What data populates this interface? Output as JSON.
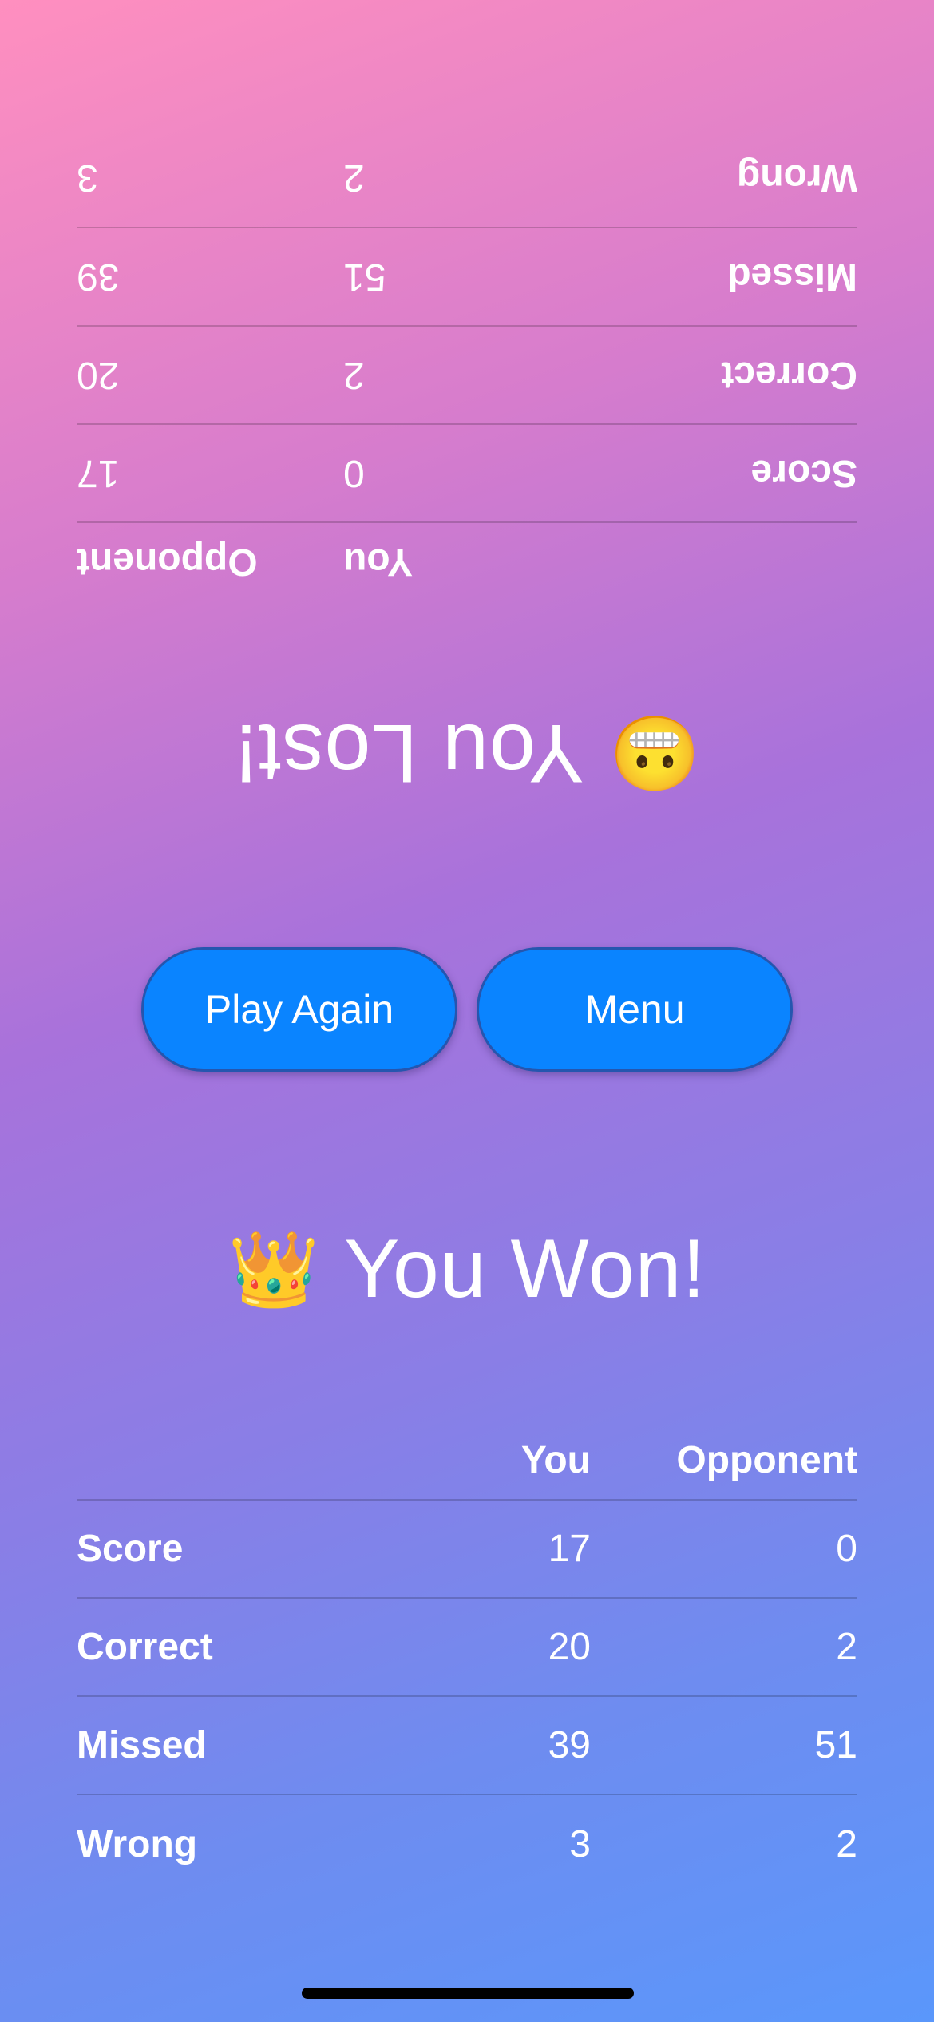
{
  "opponent_view": {
    "result_text": "You Lost!",
    "result_emoji": "😬",
    "stats": {
      "headers": {
        "label": "",
        "you": "You",
        "opponent": "Opponent"
      },
      "rows": [
        {
          "label": "Score",
          "you": "0",
          "opponent": "17"
        },
        {
          "label": "Correct",
          "you": "2",
          "opponent": "20"
        },
        {
          "label": "Missed",
          "you": "51",
          "opponent": "39"
        },
        {
          "label": "Wrong",
          "you": "2",
          "opponent": "3"
        }
      ]
    }
  },
  "buttons": {
    "play_again_label": "Play Again",
    "menu_label": "Menu"
  },
  "player_view": {
    "result_text": "You Won!",
    "result_emoji": "👑",
    "stats": {
      "headers": {
        "label": "",
        "you": "You",
        "opponent": "Opponent"
      },
      "rows": [
        {
          "label": "Score",
          "you": "17",
          "opponent": "0"
        },
        {
          "label": "Correct",
          "you": "20",
          "opponent": "2"
        },
        {
          "label": "Missed",
          "you": "39",
          "opponent": "51"
        },
        {
          "label": "Wrong",
          "you": "3",
          "opponent": "2"
        }
      ]
    }
  },
  "colors": {
    "button_blue": "#0a84ff",
    "gradient_top": "#ff8fbf",
    "gradient_bottom": "#5a97fb"
  }
}
